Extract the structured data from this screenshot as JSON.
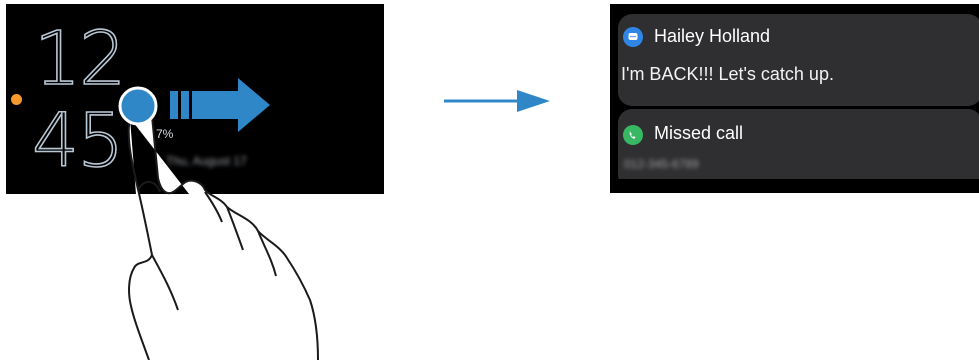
{
  "watch_left": {
    "hour": "12",
    "minute": "45",
    "battery_partial": "7%",
    "date_blurred": "Thu, August 17"
  },
  "gesture": {
    "direction": "swipe-right",
    "arrow_color": "#2f87c8"
  },
  "watch_right": {
    "notifications": [
      {
        "app_icon": "message-icon",
        "title": "Hailey Holland",
        "body": "I'm BACK!!! Let's catch up."
      },
      {
        "app_icon": "phone-icon",
        "title": "Missed call",
        "body_blurred": "012-345-6789"
      }
    ]
  },
  "colors": {
    "orange_dot": "#f59a2b",
    "clock_outline": "#b8c7d4",
    "card_bg": "#2f2f31",
    "message_icon": "#2f86e7",
    "call_icon": "#39b863"
  }
}
